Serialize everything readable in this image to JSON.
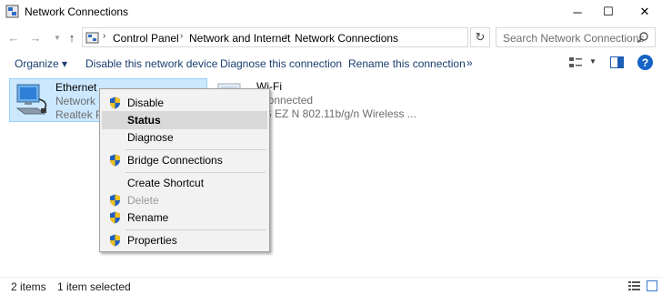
{
  "window": {
    "title": "Network Connections",
    "minimize_glyph": "─",
    "maximize_glyph": "☐",
    "close_glyph": "✕"
  },
  "nav": {
    "back_glyph": "←",
    "forward_glyph": "→",
    "recent_glyph": "▼",
    "up_glyph": "↑"
  },
  "address": {
    "breadcrumbs": [
      "Control Panel",
      "Network and Internet",
      "Network Connections"
    ],
    "separator_glyph": "›",
    "dropdown_glyph": "⌄",
    "refresh_glyph": "↻"
  },
  "search": {
    "placeholder": "Search Network Connections"
  },
  "commands": {
    "organize": "Organize ▾",
    "disable": "Disable this network device",
    "diagnose": "Diagnose this connection",
    "rename": "Rename this connection",
    "more": "»",
    "view_dropdown_glyph": "▼",
    "help_glyph": "?"
  },
  "connections": [
    {
      "name": "Ethernet",
      "line1": "Network  3",
      "line2": "Realtek PC",
      "selected": true
    },
    {
      "name": "Wi-Fi",
      "line1": "t connected",
      "line2": "US EZ N 802.11b/g/n Wireless ...",
      "selected": false
    }
  ],
  "context_menu": {
    "items": [
      {
        "label": "Disable",
        "shield": true
      },
      {
        "label": "Status",
        "bold": true,
        "hover": true
      },
      {
        "label": "Diagnose"
      },
      {
        "label": "Bridge Connections",
        "shield": true
      },
      {
        "label": "Create Shortcut"
      },
      {
        "label": "Delete",
        "shield": true,
        "disabled": true
      },
      {
        "label": "Rename",
        "shield": true
      },
      {
        "label": "Properties",
        "shield": true
      }
    ]
  },
  "status": {
    "items_count": "2 items",
    "selected": "1 item selected"
  },
  "colors": {
    "selection_bg": "#cce8ff",
    "selection_border": "#99d1ff",
    "command_text": "#1a3e6e",
    "help_blue": "#1663c7"
  }
}
